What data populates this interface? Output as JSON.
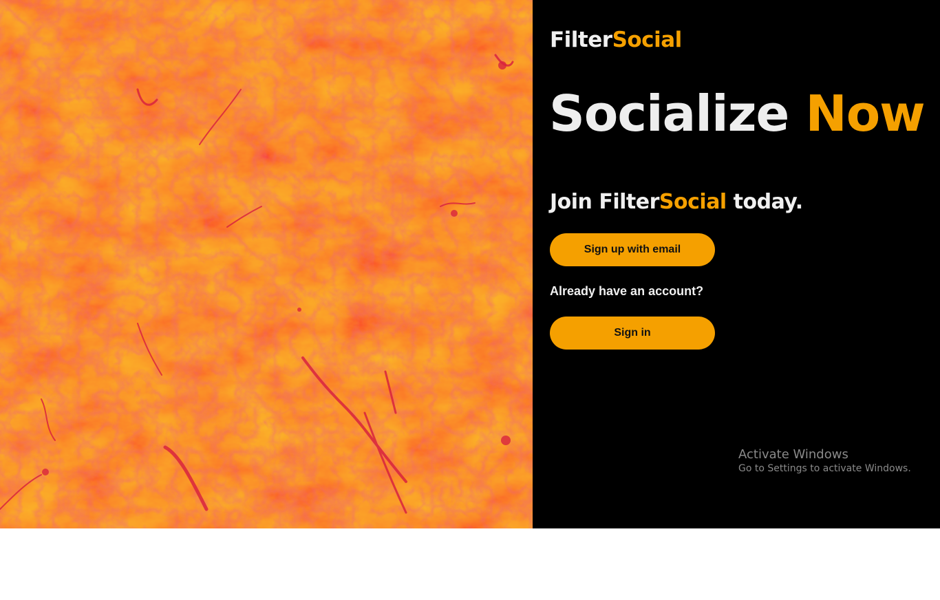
{
  "brand": {
    "name_part1": "Filter",
    "name_part2": "Social"
  },
  "headline": {
    "part1": "Socialize ",
    "part2": "Now"
  },
  "join": {
    "prefix": "Join ",
    "brand_part1": "Filter",
    "brand_part2": "Social",
    "suffix": " today."
  },
  "actions": {
    "signup_label": "Sign up with email",
    "already_text": "Already have an account?",
    "signin_label": "Sign in"
  },
  "watermark": {
    "title": "Activate Windows",
    "subtitle": "Go to Settings to activate Windows."
  },
  "colors": {
    "accent": "#f5a000",
    "panel_background": "#000000",
    "hero_base": "#f97a0c",
    "hero_veins": "#d81e3a"
  }
}
